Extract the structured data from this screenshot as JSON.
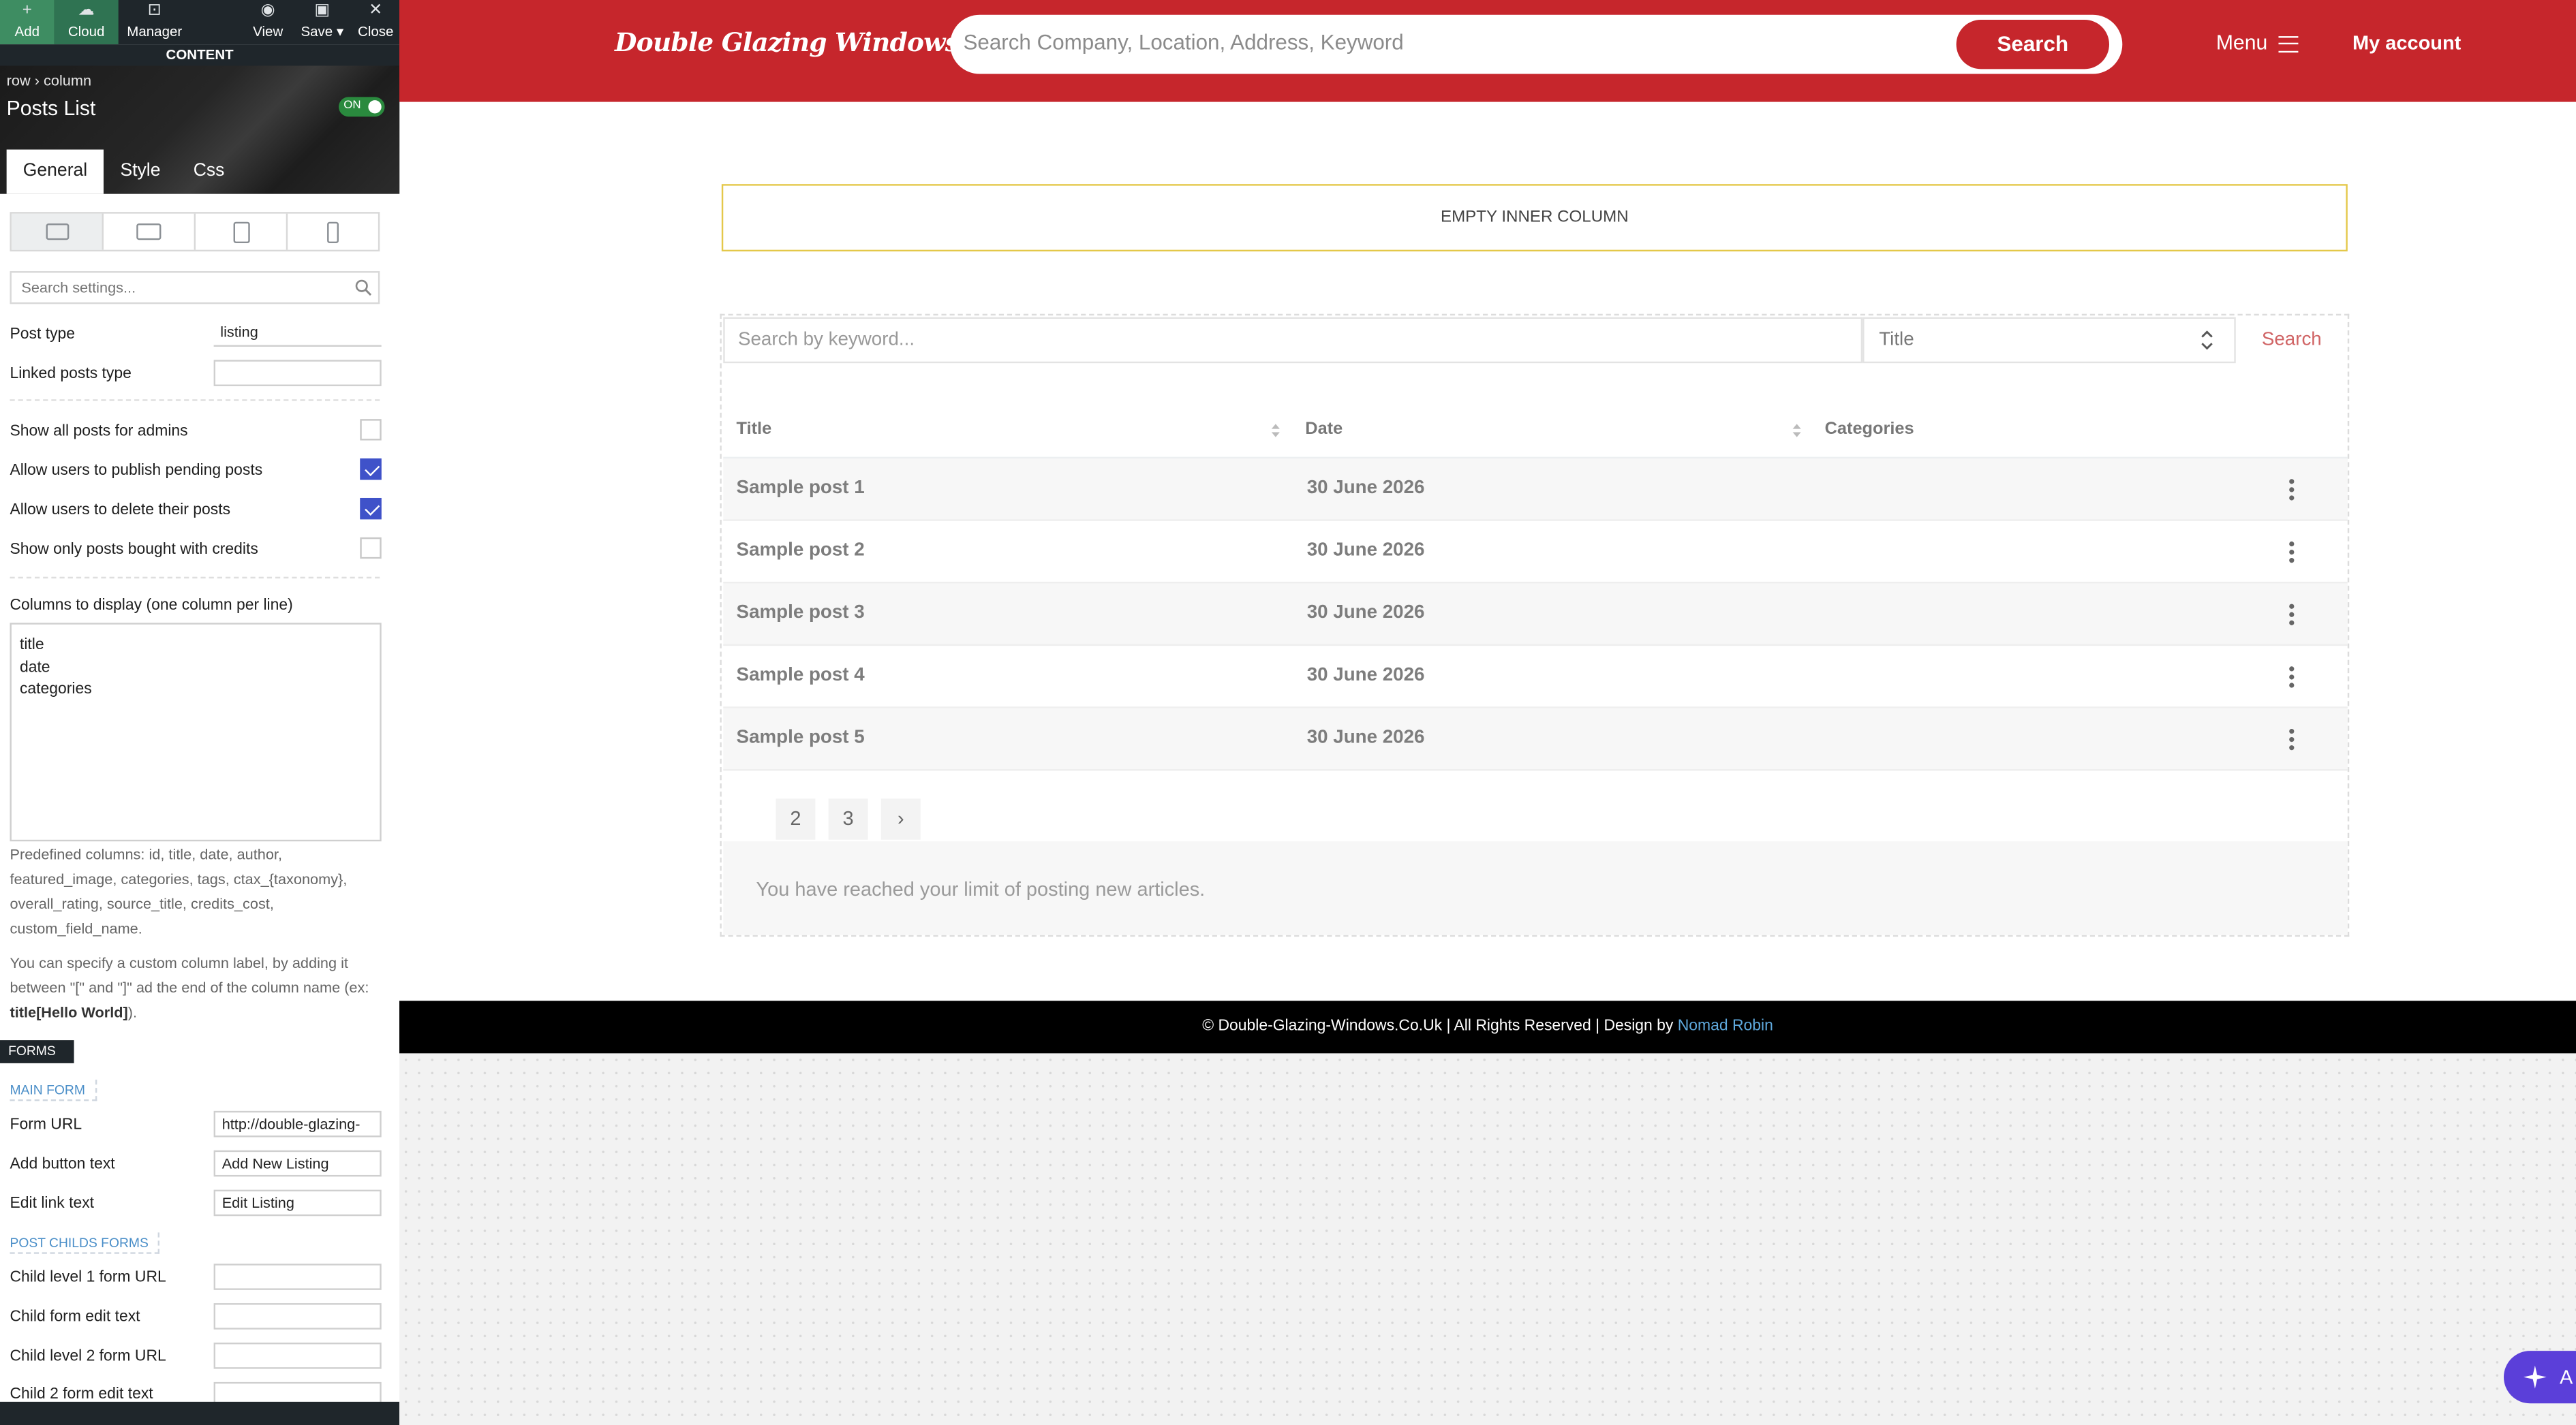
{
  "editor": {
    "toolbar": {
      "add": "Add",
      "cloud": "Cloud",
      "manager": "Manager",
      "view": "View",
      "save": "Save",
      "close": "Close"
    },
    "section_bar": "CONTENT",
    "breadcrumb": {
      "row": "row",
      "sep": "›",
      "column": "column"
    },
    "element_title": "Posts List",
    "toggle_label": "ON",
    "tabs": [
      "General",
      "Style",
      "Css"
    ],
    "search_placeholder": "Search settings...",
    "post_type": {
      "label": "Post type",
      "value": "listing"
    },
    "linked_posts_type": {
      "label": "Linked posts type",
      "value": ""
    },
    "checkboxes": [
      {
        "label": "Show all posts for admins",
        "checked": false
      },
      {
        "label": "Allow users to publish pending posts",
        "checked": true
      },
      {
        "label": "Allow users to delete their posts",
        "checked": true
      },
      {
        "label": "Show only posts bought with credits",
        "checked": false
      }
    ],
    "columns_label": "Columns to display (one column per line)",
    "columns_value": "title\ndate\ncategories",
    "help_predefined": "Predefined columns: id, title, date, author, featured_image, categories, tags, ctax_{taxonomy}, overall_rating, source_title, credits_cost, custom_field_name.",
    "help_custom_prefix": "You can specify a custom column label, by adding it between \"[\" and \"]\" ad the end of the column name (ex: ",
    "help_custom_example": "title[Hello World]",
    "help_custom_suffix": ").",
    "forms_bar": "FORMS",
    "main_form_label": "MAIN FORM",
    "form_url": {
      "label": "Form URL",
      "value": "http://double-glazing-"
    },
    "add_button_text": {
      "label": "Add button text",
      "value": "Add New Listing"
    },
    "edit_link_text": {
      "label": "Edit link text",
      "value": "Edit Listing"
    },
    "post_childs_label": "POST CHILDS FORMS",
    "child1_url": {
      "label": "Child level 1 form URL",
      "value": ""
    },
    "child1_edit": {
      "label": "Child form edit text",
      "value": ""
    },
    "child2_url": {
      "label": "Child level 2 form URL",
      "value": ""
    },
    "child2_edit": {
      "label": "Child 2 form edit text",
      "value": ""
    }
  },
  "site": {
    "logo": "Double Glazing Windows",
    "search_placeholder": "Search Company, Location, Address, Keyword",
    "search_button": "Search",
    "menu": "Menu",
    "account": "My account",
    "empty_column": "EMPTY INNER COLUMN",
    "filter": {
      "keyword_placeholder": "Search by keyword...",
      "sort_value": "Title",
      "search_button": "Search"
    },
    "table": {
      "headers": [
        "Title",
        "Date",
        "Categories"
      ],
      "rows": [
        {
          "title": "Sample post 1",
          "date": "30 June 2026"
        },
        {
          "title": "Sample post 2",
          "date": "30 June 2026"
        },
        {
          "title": "Sample post 3",
          "date": "30 June 2026"
        },
        {
          "title": "Sample post 4",
          "date": "30 June 2026"
        },
        {
          "title": "Sample post 5",
          "date": "30 June 2026"
        }
      ]
    },
    "pagination": [
      "2",
      "3",
      "›"
    ],
    "limit_message": "You have reached your limit of posting new articles.",
    "footer": {
      "text": "© Double-Glazing-Windows.Co.Uk | All Rights Reserved | Design by ",
      "link": "Nomad Robin"
    },
    "ai_badge": "A"
  },
  "colors": {
    "brand_red": "#c6262c",
    "editor_dark": "#1f262b",
    "check_blue": "#3f52c9",
    "link_blue": "#4a8ec8",
    "ai_purple": "#5b3fd9"
  }
}
